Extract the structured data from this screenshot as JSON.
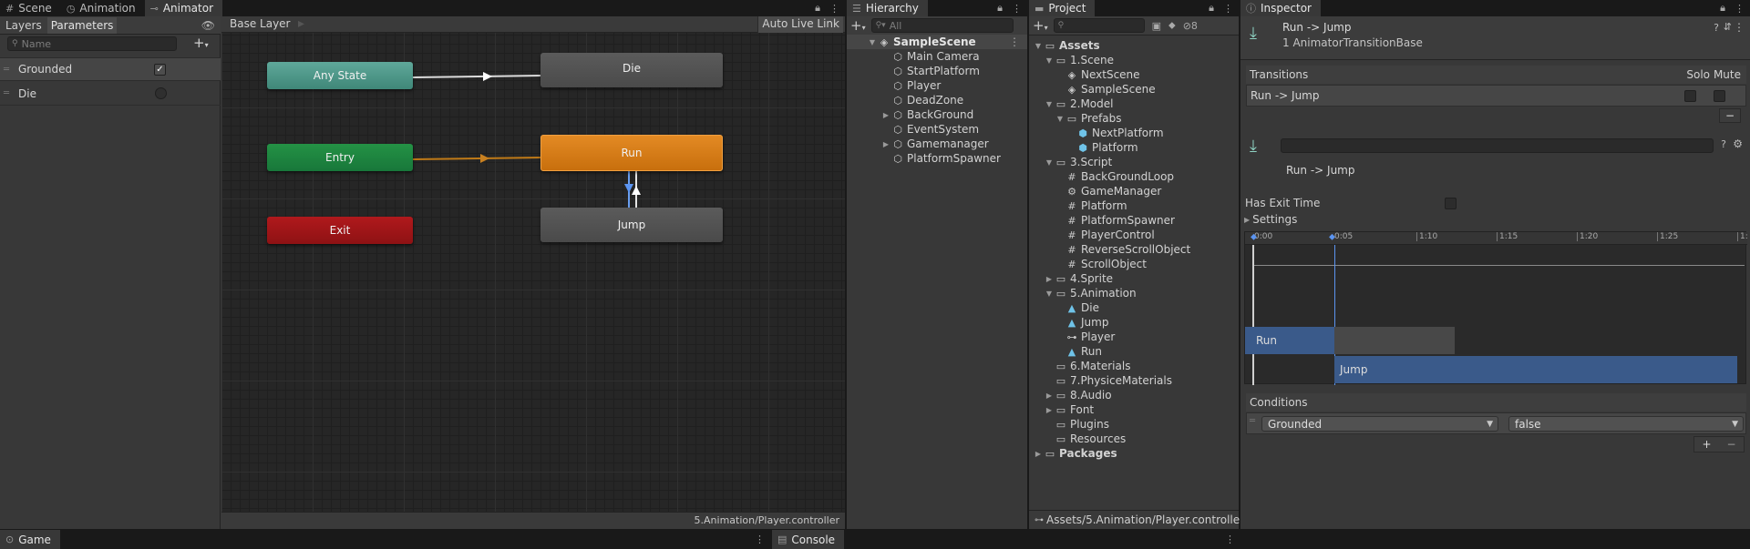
{
  "tabs": {
    "scene": "Scene",
    "animation": "Animation",
    "animator": "Animator",
    "hierarchy": "Hierarchy",
    "project": "Project",
    "inspector": "Inspector",
    "game": "Game",
    "console": "Console"
  },
  "animator": {
    "layers_tab": "Layers",
    "parameters_tab": "Parameters",
    "name_placeholder": "Name",
    "breadcrumb": "Base Layer",
    "auto_live_link": "Auto Live Link",
    "footer_path": "5.Animation/Player.controller",
    "parameters": [
      {
        "name": "Grounded",
        "type": "bool",
        "value": true
      },
      {
        "name": "Die",
        "type": "trigger",
        "value": false
      }
    ],
    "states": {
      "any_state": "Any State",
      "entry": "Entry",
      "exit": "Exit",
      "die": "Die",
      "run": "Run",
      "jump": "Jump"
    }
  },
  "hierarchy": {
    "search_placeholder": "All",
    "scene_name": "SampleScene",
    "objects": [
      "Main Camera",
      "StartPlatform",
      "Player",
      "DeadZone",
      "BackGround",
      "EventSystem",
      "Gamemanager",
      "PlatformSpawner"
    ]
  },
  "project": {
    "visibility_count": "8",
    "footer_path": "Assets/5.Animation/Player.controller",
    "assets": "Assets",
    "scene_folder": "1.Scene",
    "scenes": [
      "NextScene",
      "SampleScene"
    ],
    "model_folder": "2.Model",
    "prefabs_folder": "Prefabs",
    "prefabs": [
      "NextPlatform",
      "Platform"
    ],
    "script_folder": "3.Script",
    "scripts": [
      "BackGroundLoop",
      "GameManager",
      "Platform",
      "PlatformSpawner",
      "PlayerControl",
      "ReverseScrollObject",
      "ScrollObject"
    ],
    "sprite_folder": "4.Sprite",
    "animation_folder": "5.Animation",
    "animations": [
      "Die",
      "Jump",
      "Player",
      "Run"
    ],
    "other_folders": [
      "6.Materials",
      "7.PhysiceMaterials",
      "8.Audio",
      "Font",
      "Plugins",
      "Resources"
    ],
    "packages": "Packages"
  },
  "inspector": {
    "title": "Run -> Jump",
    "subtitle": "1 AnimatorTransitionBase",
    "transitions_label": "Transitions",
    "solo_label": "Solo",
    "mute_label": "Mute",
    "transition_item": "Run -> Jump",
    "transition_name": "Run -> Jump",
    "has_exit_time_label": "Has Exit Time",
    "settings_label": "Settings",
    "timeline_ticks": [
      "0:00",
      "0:05",
      "1:10",
      "1:15",
      "1:20",
      "1:25",
      "1:"
    ],
    "timeline_run": "Run",
    "timeline_jump": "Jump",
    "conditions_label": "Conditions",
    "condition_param": "Grounded",
    "condition_value": "false"
  }
}
